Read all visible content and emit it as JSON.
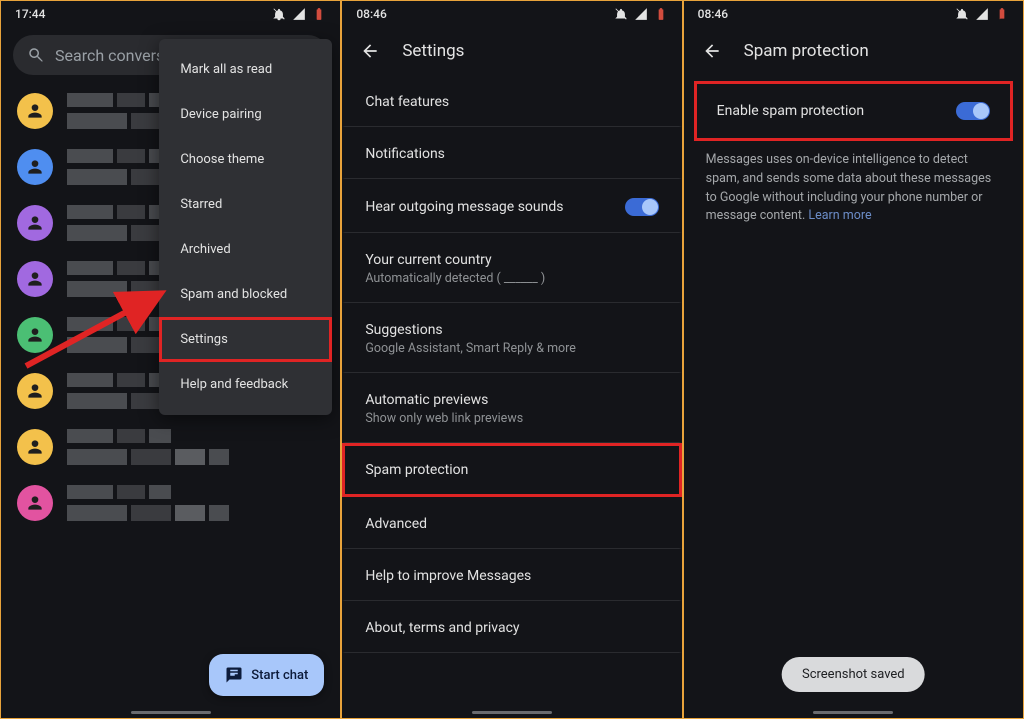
{
  "screen1": {
    "time": "17:44",
    "search_placeholder": "Search conversat",
    "menu": [
      "Mark all as read",
      "Device pairing",
      "Choose theme",
      "Starred",
      "Archived",
      "Spam and blocked",
      "Settings",
      "Help and feedback"
    ],
    "menu_highlight_index": 6,
    "fab_label": "Start chat",
    "avatar_colors": [
      "#f3c14b",
      "#4f8ef0",
      "#a169e0",
      "#a169e0",
      "#4bbf74",
      "#f3c14b",
      "#f3c14b",
      "#e253a0"
    ]
  },
  "screen2": {
    "time": "08:46",
    "title": "Settings",
    "rows": [
      {
        "label": "Chat features"
      },
      {
        "label": "Notifications"
      },
      {
        "label": "Hear outgoing message sounds",
        "toggle": true
      },
      {
        "label": "Your current country",
        "sub": "Automatically detected ( ______ )"
      },
      {
        "label": "Suggestions",
        "sub": "Google Assistant, Smart Reply & more"
      },
      {
        "label": "Automatic previews",
        "sub": "Show only web link previews"
      },
      {
        "label": "Spam protection",
        "highlight": true
      },
      {
        "label": "Advanced"
      },
      {
        "label": "Help to improve Messages"
      },
      {
        "label": "About, terms and privacy"
      }
    ]
  },
  "screen3": {
    "time": "08:46",
    "title": "Spam protection",
    "enable_label": "Enable spam protection",
    "description": "Messages uses on-device intelligence to detect spam, and sends some data about these messages to Google without including your phone number or message content.",
    "learn_more": "Learn more",
    "toast": "Screenshot saved"
  }
}
